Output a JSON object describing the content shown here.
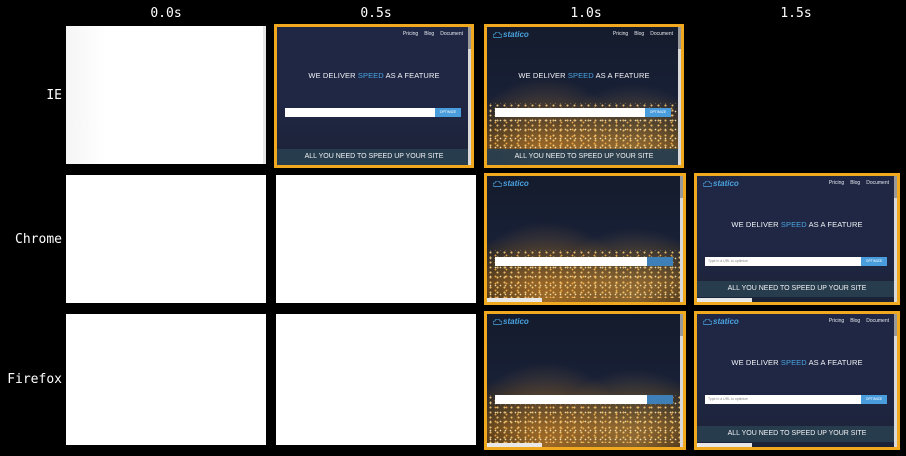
{
  "columns": [
    "0.0s",
    "0.5s",
    "1.0s",
    "1.5s"
  ],
  "rows": [
    "IE",
    "Chrome",
    "Firefox"
  ],
  "site": {
    "logo": "statico",
    "nav": [
      "Pricing",
      "Blog",
      "Document"
    ],
    "headline_pre": "WE DELIVER",
    "headline_accent": "SPEED",
    "headline_post": "AS A FEATURE",
    "search_button": "OPTIMIZE",
    "search_placeholder": "Type in a URL to optimize",
    "band": "ALL YOU NEED TO SPEED UP YOUR SITE"
  },
  "colors": {
    "highlight": "#f0a91e",
    "accent": "#4aa3e0",
    "background": "#000000"
  },
  "frames": [
    {
      "row": 0,
      "col": 0,
      "state": "blank"
    },
    {
      "row": 0,
      "col": 1,
      "state": "no-image",
      "highlighted": true
    },
    {
      "row": 0,
      "col": 2,
      "state": "city",
      "highlighted": true
    },
    {
      "row": 0,
      "col": 3,
      "state": "empty"
    },
    {
      "row": 1,
      "col": 0,
      "state": "blank"
    },
    {
      "row": 1,
      "col": 1,
      "state": "blank"
    },
    {
      "row": 1,
      "col": 2,
      "state": "city-partial",
      "highlighted": true
    },
    {
      "row": 1,
      "col": 3,
      "state": "no-image",
      "highlighted": true
    },
    {
      "row": 2,
      "col": 0,
      "state": "blank"
    },
    {
      "row": 2,
      "col": 1,
      "state": "blank"
    },
    {
      "row": 2,
      "col": 2,
      "state": "city-partial",
      "highlighted": true
    },
    {
      "row": 2,
      "col": 3,
      "state": "no-image",
      "highlighted": true
    }
  ]
}
